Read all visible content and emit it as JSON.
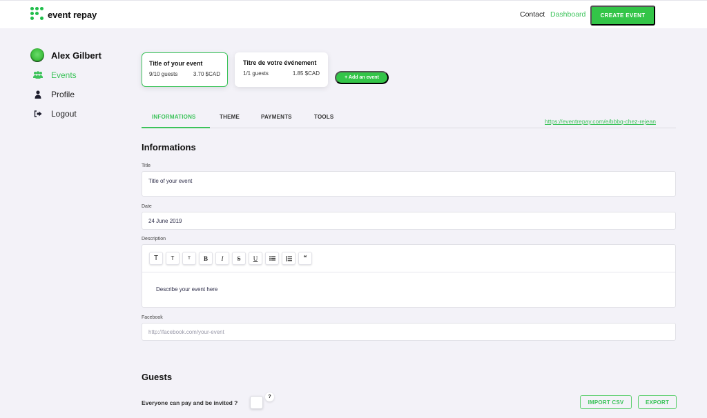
{
  "header": {
    "brand": "event repay",
    "nav": {
      "contact": "Contact",
      "dashboard": "Dashboard"
    },
    "create_button": "CREATE EVENT"
  },
  "sidebar": {
    "user_name": "Alex Gilbert",
    "items": [
      {
        "label": "Events",
        "icon": "users-icon",
        "active": true
      },
      {
        "label": "Profile",
        "icon": "user-icon",
        "active": false
      },
      {
        "label": "Logout",
        "icon": "sign-out-icon",
        "active": false
      }
    ]
  },
  "events": [
    {
      "title": "Title of your event",
      "guests": "9/10 guests",
      "amount": "3.70 $CAD",
      "selected": true
    },
    {
      "title": "Titre de votre événement",
      "guests": "1/1 guests",
      "amount": "1.85 $CAD",
      "selected": false
    }
  ],
  "add_event_button": "+ Add an event",
  "tabs": [
    {
      "label": "INFORMATIONS",
      "active": true
    },
    {
      "label": "THEME",
      "active": false
    },
    {
      "label": "PAYMENTS",
      "active": false
    },
    {
      "label": "TOOLS",
      "active": false
    }
  ],
  "event_url": "https://eventrepay.com/e/bbbq-chez-rejean",
  "informations": {
    "heading": "Informations",
    "title": {
      "label": "Title",
      "value": "Title of your event"
    },
    "date": {
      "label": "Date",
      "value": "24 June 2019"
    },
    "description": {
      "label": "Description",
      "toolbar": [
        "T",
        "T",
        "T",
        "B",
        "I",
        "S",
        "U",
        "bulleted-list",
        "numbered-list",
        "quote"
      ],
      "value": "Describe your event here"
    },
    "facebook": {
      "label": "Facebook",
      "placeholder": "http://facebook.com/your-event"
    }
  },
  "guests": {
    "heading": "Guests",
    "everyone_label": "Everyone can pay and be invited ?",
    "everyone_checked": false,
    "help": "?",
    "import_button": "IMPORT CSV",
    "export_button": "EXPORT"
  },
  "colors": {
    "accent": "#33c548",
    "link": "#3cc35a",
    "background": "#f3f2f8"
  }
}
